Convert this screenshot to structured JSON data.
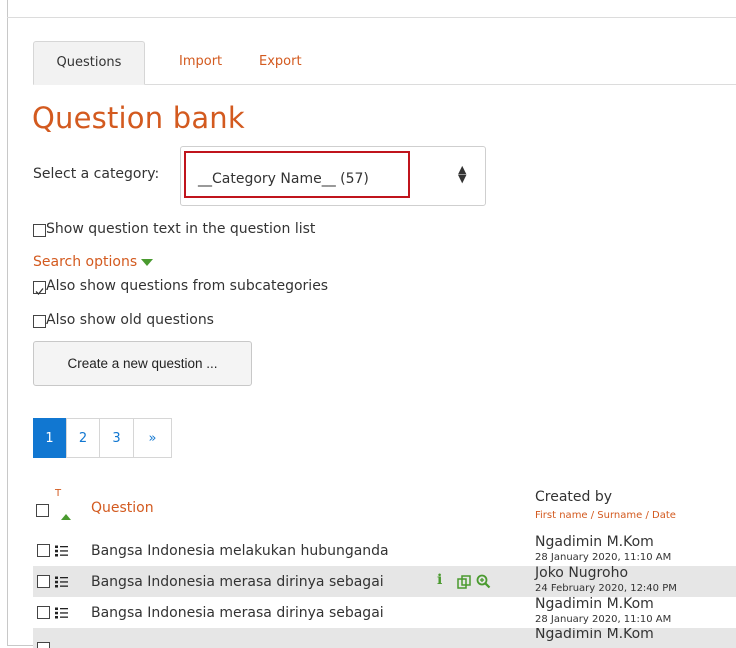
{
  "tabs": {
    "questions": "Questions",
    "import": "Import",
    "export": "Export"
  },
  "page_title": "Question bank",
  "category": {
    "label": "Select a category:",
    "selected": "__Category Name__ (57)"
  },
  "show_question_text": "Show question text in the question list",
  "search_options": "Search options",
  "subcategories": "Also show questions from subcategories",
  "old_questions": "Also show old questions",
  "create_button": "Create a new question ...",
  "pagination": [
    "1",
    "2",
    "3",
    "»"
  ],
  "table": {
    "type_header_letter": "T",
    "question_header": "Question",
    "created_by": "Created by",
    "created_sub": "First name / Surname / Date",
    "rows": [
      {
        "question": "Bangsa Indonesia melakukan hubunganda",
        "name": "Ngadimin M.Kom",
        "date": "28 January 2020, 11:10 AM"
      },
      {
        "question": "Bangsa Indonesia merasa dirinya sebagai",
        "name": "Joko Nugroho",
        "date": "24 February 2020, 12:40 PM"
      },
      {
        "question": "Bangsa Indonesia merasa dirinya sebagai",
        "name": "Ngadimin M.Kom",
        "date": "28 January 2020, 11:10 AM"
      },
      {
        "question": "",
        "name": "Ngadimin M.Kom",
        "date": ""
      }
    ]
  },
  "colors": {
    "accent": "#d35a1f",
    "link_blue": "#1177d1",
    "highlight_red": "#c0141c",
    "icon_green": "#4a9a2f"
  },
  "icons": [
    "sort-ascending-icon",
    "multichoice-list-icon",
    "info-icon",
    "duplicate-icon",
    "preview-zoom-icon",
    "select-arrows-icon",
    "dropdown-triangle-icon"
  ]
}
